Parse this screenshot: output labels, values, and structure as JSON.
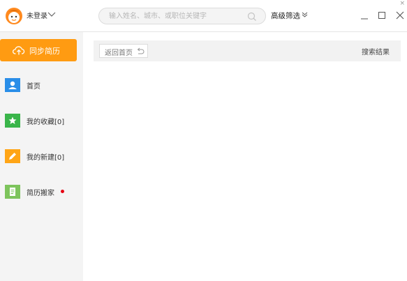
{
  "header": {
    "login_label": "未登录",
    "search_placeholder": "输入姓名、城市、或职位关键字",
    "advanced_filter_label": "高级筛选",
    "close_glyph": "×"
  },
  "sidebar": {
    "sync_button_label": "同步简历",
    "items": [
      {
        "label": "首页",
        "icon": "person-icon",
        "color": "#2a8ee8"
      },
      {
        "label": "我的收藏[0]",
        "icon": "star-icon",
        "color": "#3ab54a"
      },
      {
        "label": "我的新建[0]",
        "icon": "pencil-icon",
        "color": "#ffa516"
      },
      {
        "label": "简历搬家",
        "icon": "document-icon",
        "color": "#7dc45c"
      }
    ]
  },
  "main": {
    "back_button_label": "返回首页",
    "results_label": "搜索结果"
  },
  "colors": {
    "accent": "#ff9b12",
    "sidebar_bg": "#f4f4f4",
    "notification_dot": "#e60012"
  }
}
